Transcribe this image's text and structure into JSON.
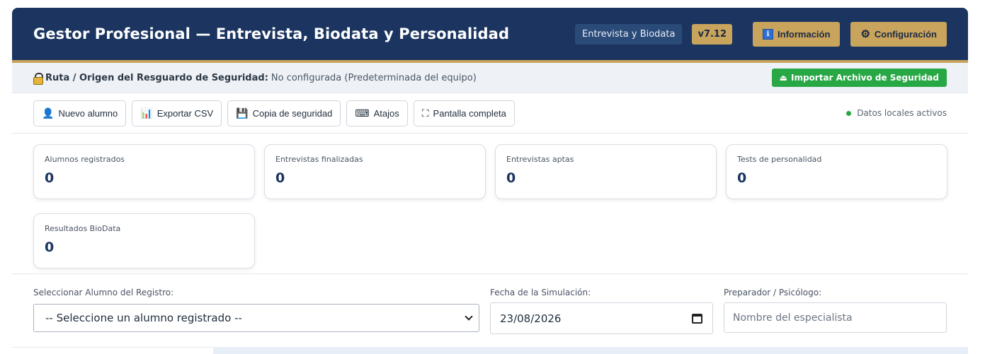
{
  "header": {
    "title": "Gestor Profesional — Entrevista, Biodata y Personalidad",
    "tag": "Entrevista y Biodata",
    "version": "v7.12",
    "info_label": "Información",
    "config_label": "Configuración"
  },
  "backup": {
    "label": "Ruta / Origen del Resguardo de Seguridad:",
    "value": "No configurada (Predeterminada del equipo)",
    "import_label": "Importar Archivo de Seguridad"
  },
  "toolbar": {
    "new_student": "Nuevo alumno",
    "export_csv": "Exportar CSV",
    "backup_copy": "Copia de seguridad",
    "shortcuts": "Atajos",
    "fullscreen": "Pantalla completa",
    "status": "Datos locales activos"
  },
  "stats": [
    {
      "label": "Alumnos registrados",
      "value": "0"
    },
    {
      "label": "Entrevistas finalizadas",
      "value": "0"
    },
    {
      "label": "Entrevistas aptas",
      "value": "0"
    },
    {
      "label": "Tests de personalidad",
      "value": "0"
    },
    {
      "label": "Resultados BioData",
      "value": "0"
    }
  ],
  "form": {
    "student_label": "Seleccionar Alumno del Registro:",
    "student_value": "-- Seleccione un alumno registrado --",
    "date_label": "Fecha de la Simulación:",
    "date_value": "23/08/2026",
    "preparer_label": "Preparador / Psicólogo:",
    "preparer_placeholder": "Nombre del especialista"
  },
  "colors": {
    "header_bg": "#1b3560",
    "accent_gold": "#c9a45c",
    "success_green": "#28a745"
  }
}
